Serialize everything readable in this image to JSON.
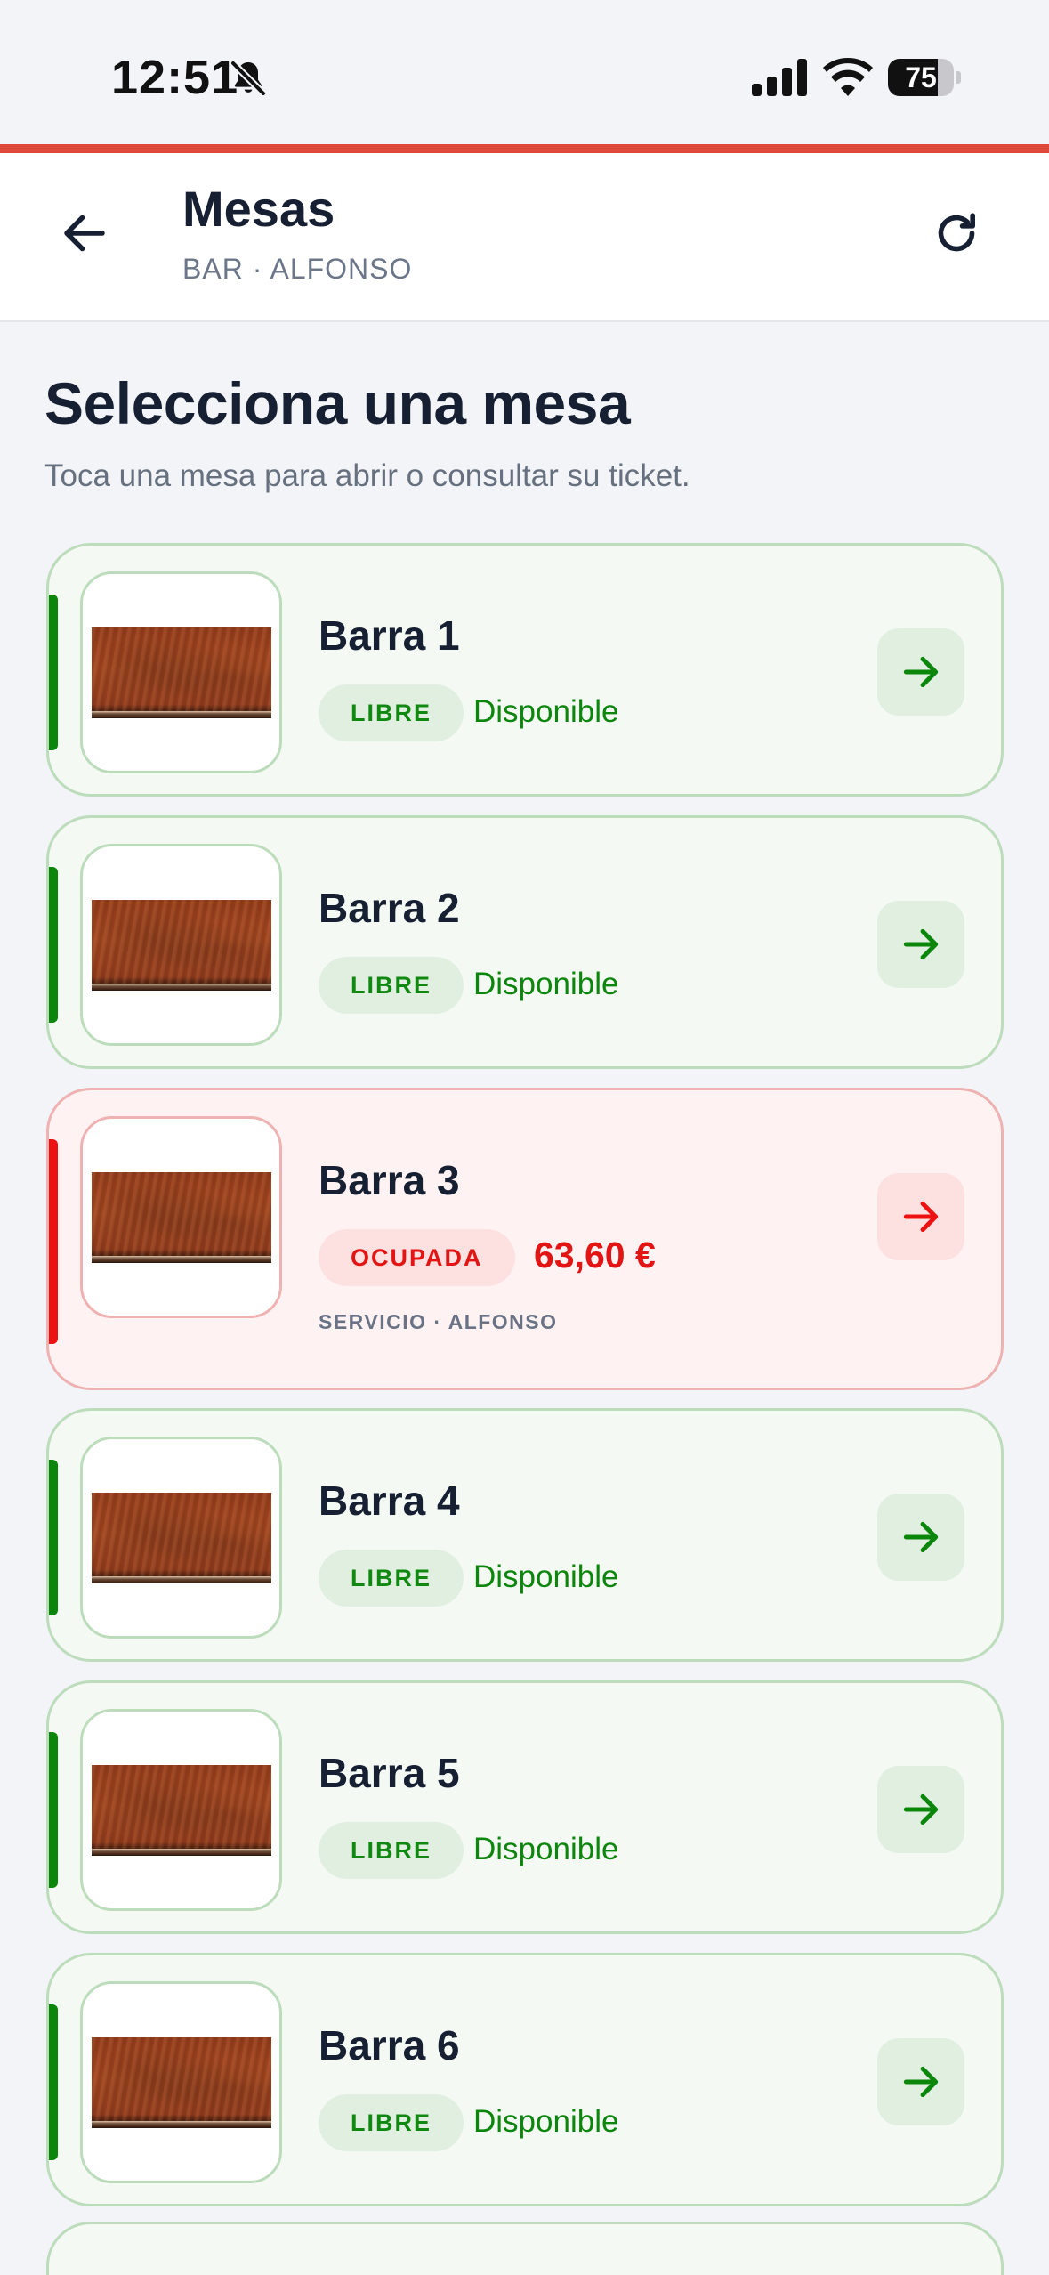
{
  "status_bar": {
    "time": "12:51",
    "battery_percent": "75",
    "battery_level": 0.75,
    "icons": [
      "bell-slash-icon",
      "cellular-signal-icon",
      "wifi-icon",
      "battery-icon"
    ]
  },
  "colors": {
    "accent": "#de4a3a",
    "free": "#0a860a",
    "busy": "#ee1111",
    "text_dark": "#172033",
    "text_muted": "#6b7689"
  },
  "header": {
    "title": "Mesas",
    "subtitle": "BAR · ALFONSO",
    "back_icon": "arrow-left-icon",
    "refresh_icon": "refresh-icon"
  },
  "main": {
    "title": "Selecciona una mesa",
    "description": "Toca una mesa para abrir o consultar su ticket."
  },
  "tables": [
    {
      "name": "Barra 1",
      "status": "LIBRE",
      "status_text": "Disponible",
      "state": "free"
    },
    {
      "name": "Barra 2",
      "status": "LIBRE",
      "status_text": "Disponible",
      "state": "free"
    },
    {
      "name": "Barra 3",
      "status": "OCUPADA",
      "amount": "63,60 €",
      "service": "SERVICIO · ALFONSO",
      "state": "busy"
    },
    {
      "name": "Barra 4",
      "status": "LIBRE",
      "status_text": "Disponible",
      "state": "free"
    },
    {
      "name": "Barra 5",
      "status": "LIBRE",
      "status_text": "Disponible",
      "state": "free"
    },
    {
      "name": "Barra 6",
      "status": "LIBRE",
      "status_text": "Disponible",
      "state": "free"
    }
  ]
}
